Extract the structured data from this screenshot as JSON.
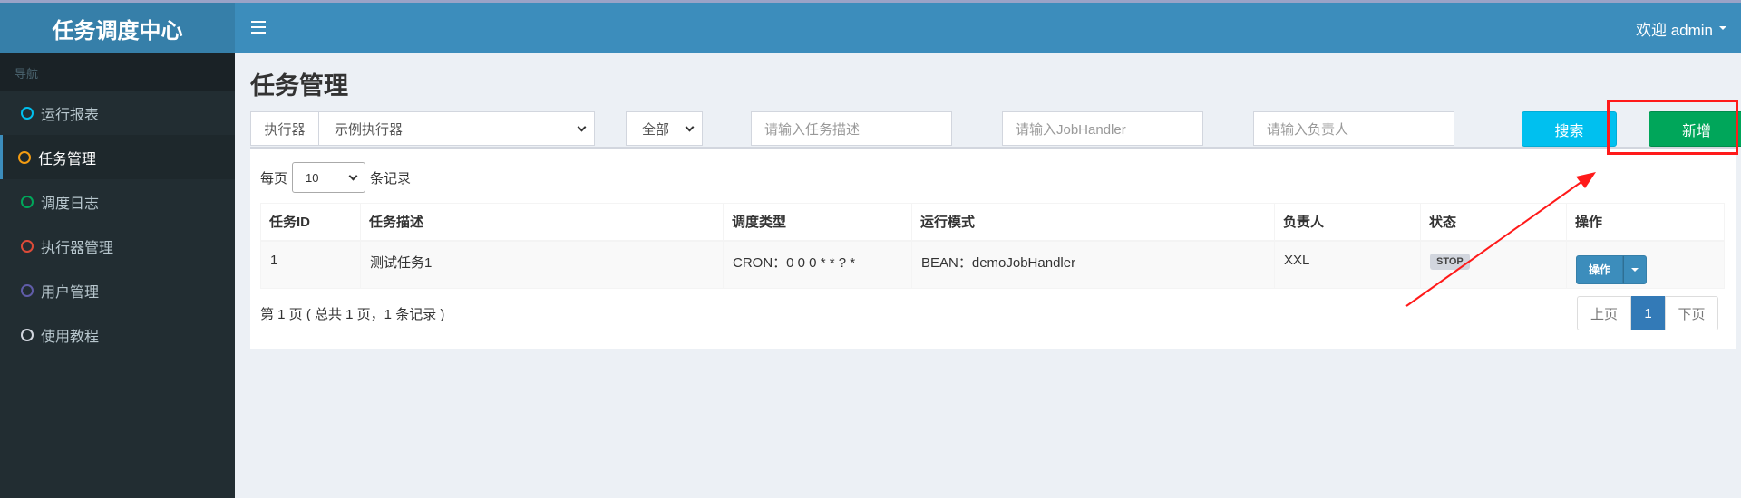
{
  "app": {
    "title": "任务调度中心",
    "user_label": "欢迎 admin"
  },
  "sidebar": {
    "header": "导航",
    "items": [
      {
        "label": "运行报表",
        "color": "#00c0ef",
        "active": false
      },
      {
        "label": "任务管理",
        "color": "#f39c12",
        "active": true
      },
      {
        "label": "调度日志",
        "color": "#00a65a",
        "active": false
      },
      {
        "label": "执行器管理",
        "color": "#dd4b39",
        "active": false
      },
      {
        "label": "用户管理",
        "color": "#605ca8",
        "active": false
      },
      {
        "label": "使用教程",
        "color": "#d2d6de",
        "active": false
      }
    ]
  },
  "page": {
    "title": "任务管理"
  },
  "filters": {
    "executor_label": "执行器",
    "executor_value": "示例执行器",
    "status_value": "全部",
    "job_desc_placeholder": "请输入任务描述",
    "handler_placeholder": "请输入JobHandler",
    "author_placeholder": "请输入负责人",
    "search_label": "搜索",
    "add_label": "新增"
  },
  "table": {
    "length_prefix": "每页",
    "length_value": "10",
    "length_suffix": "条记录",
    "columns": [
      "任务ID",
      "任务描述",
      "调度类型",
      "运行模式",
      "负责人",
      "状态",
      "操作"
    ],
    "rows": [
      {
        "id": "1",
        "desc": "测试任务1",
        "schedule": "CRON：0 0 0 * * ? *",
        "mode": "BEAN：demoJobHandler",
        "author": "XXL",
        "status": "STOP",
        "action": "操作"
      }
    ],
    "info": "第 1 页 ( 总共 1 页，1 条记录 )"
  },
  "pagination": {
    "prev": "上页",
    "current": "1",
    "next": "下页"
  },
  "annotation": {
    "color": "#ff1a1a"
  }
}
